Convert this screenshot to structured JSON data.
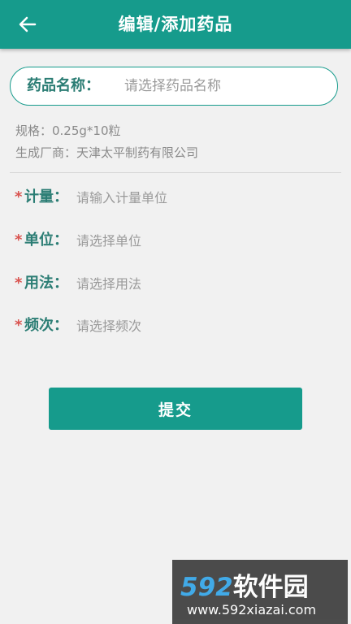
{
  "header": {
    "title": "编辑/添加药品",
    "back_icon": "arrow-left-icon"
  },
  "drug_name": {
    "label": "药品名称：",
    "placeholder": "请选择药品名称"
  },
  "info": {
    "spec": "规格：0.25g*10粒",
    "manufacturer": "生成厂商：天津太平制药有限公司"
  },
  "fields": [
    {
      "star": "*",
      "label": "计量：",
      "placeholder": "请输入计量单位"
    },
    {
      "star": "*",
      "label": "单位：",
      "placeholder": "请选择单位"
    },
    {
      "star": "*",
      "label": "用法：",
      "placeholder": "请选择用法"
    },
    {
      "star": "*",
      "label": "频次：",
      "placeholder": "请选择频次"
    }
  ],
  "submit": {
    "label": "提交"
  },
  "watermark": {
    "number": "592",
    "text": "软件园",
    "url": "www.592xiazai.com"
  },
  "colors": {
    "primary": "#169b8c",
    "label": "#2b7d74",
    "required": "#d9534f",
    "background": "#f1f1f1"
  }
}
